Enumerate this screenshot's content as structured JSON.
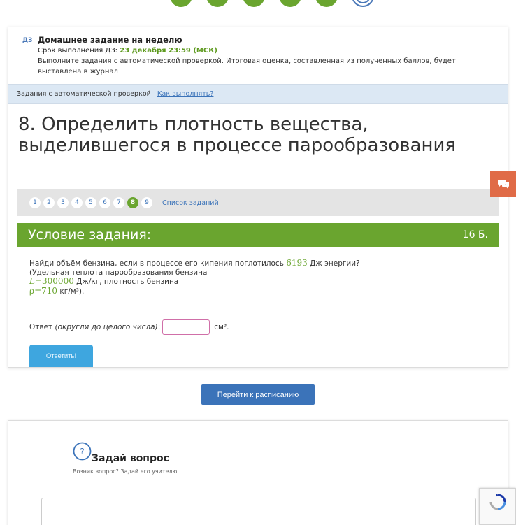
{
  "homework": {
    "tag": "ДЗ",
    "title": "Домашнее задание на неделю",
    "deadline_label": "Срок выполнения ДЗ: ",
    "deadline_date": "23 декабря 23:59 (МСК)",
    "description": "Выполните задания с автоматической проверкой. Итоговая оценка, составленная из полученных баллов, будет выставлена в журнал"
  },
  "auto_bar": {
    "label": "Задания с автоматической проверкой",
    "how_link": "Как выполнять?"
  },
  "task_title": "8. Определить плотность вещества, выделившегося в процессе парообразования",
  "pager": {
    "pages": [
      "1",
      "2",
      "3",
      "4",
      "5",
      "6",
      "7",
      "8",
      "9"
    ],
    "active": "8",
    "list_link": "Список заданий"
  },
  "condition": {
    "header": "Условие задания:",
    "points": "16 Б.",
    "line1_pre": "Найди объём бензина, если в процессе его кипения поглотилось ",
    "line1_value": "6193",
    "line1_post": " Дж энергии?",
    "line2": "(Удельная теплота парообразования бензина",
    "line3_var": "L",
    "line3_eq": "=300000",
    "line3_post": " Дж/кг, плотность бензина",
    "line4_var": "ρ",
    "line4_eq": "=710",
    "line4_post": "  кг/м³)."
  },
  "answer": {
    "label_pre": "Ответ ",
    "label_hint": "(округли до целого числа)",
    "label_colon": ":",
    "unit": "см³.",
    "input_value": "",
    "submit": "Ответить!"
  },
  "schedule_button": "Перейти к расписанию",
  "ask": {
    "icon_text": "?",
    "title": "Задай вопрос",
    "subtitle": "Возник вопрос? Задай его учителю.",
    "textarea_value": ""
  },
  "colors": {
    "green": "#6aa52f",
    "blue": "#3b73b9",
    "light_blue_bar": "#dce8f4",
    "chat_orange": "#e06b47",
    "reply_button": "#3ea6df"
  }
}
